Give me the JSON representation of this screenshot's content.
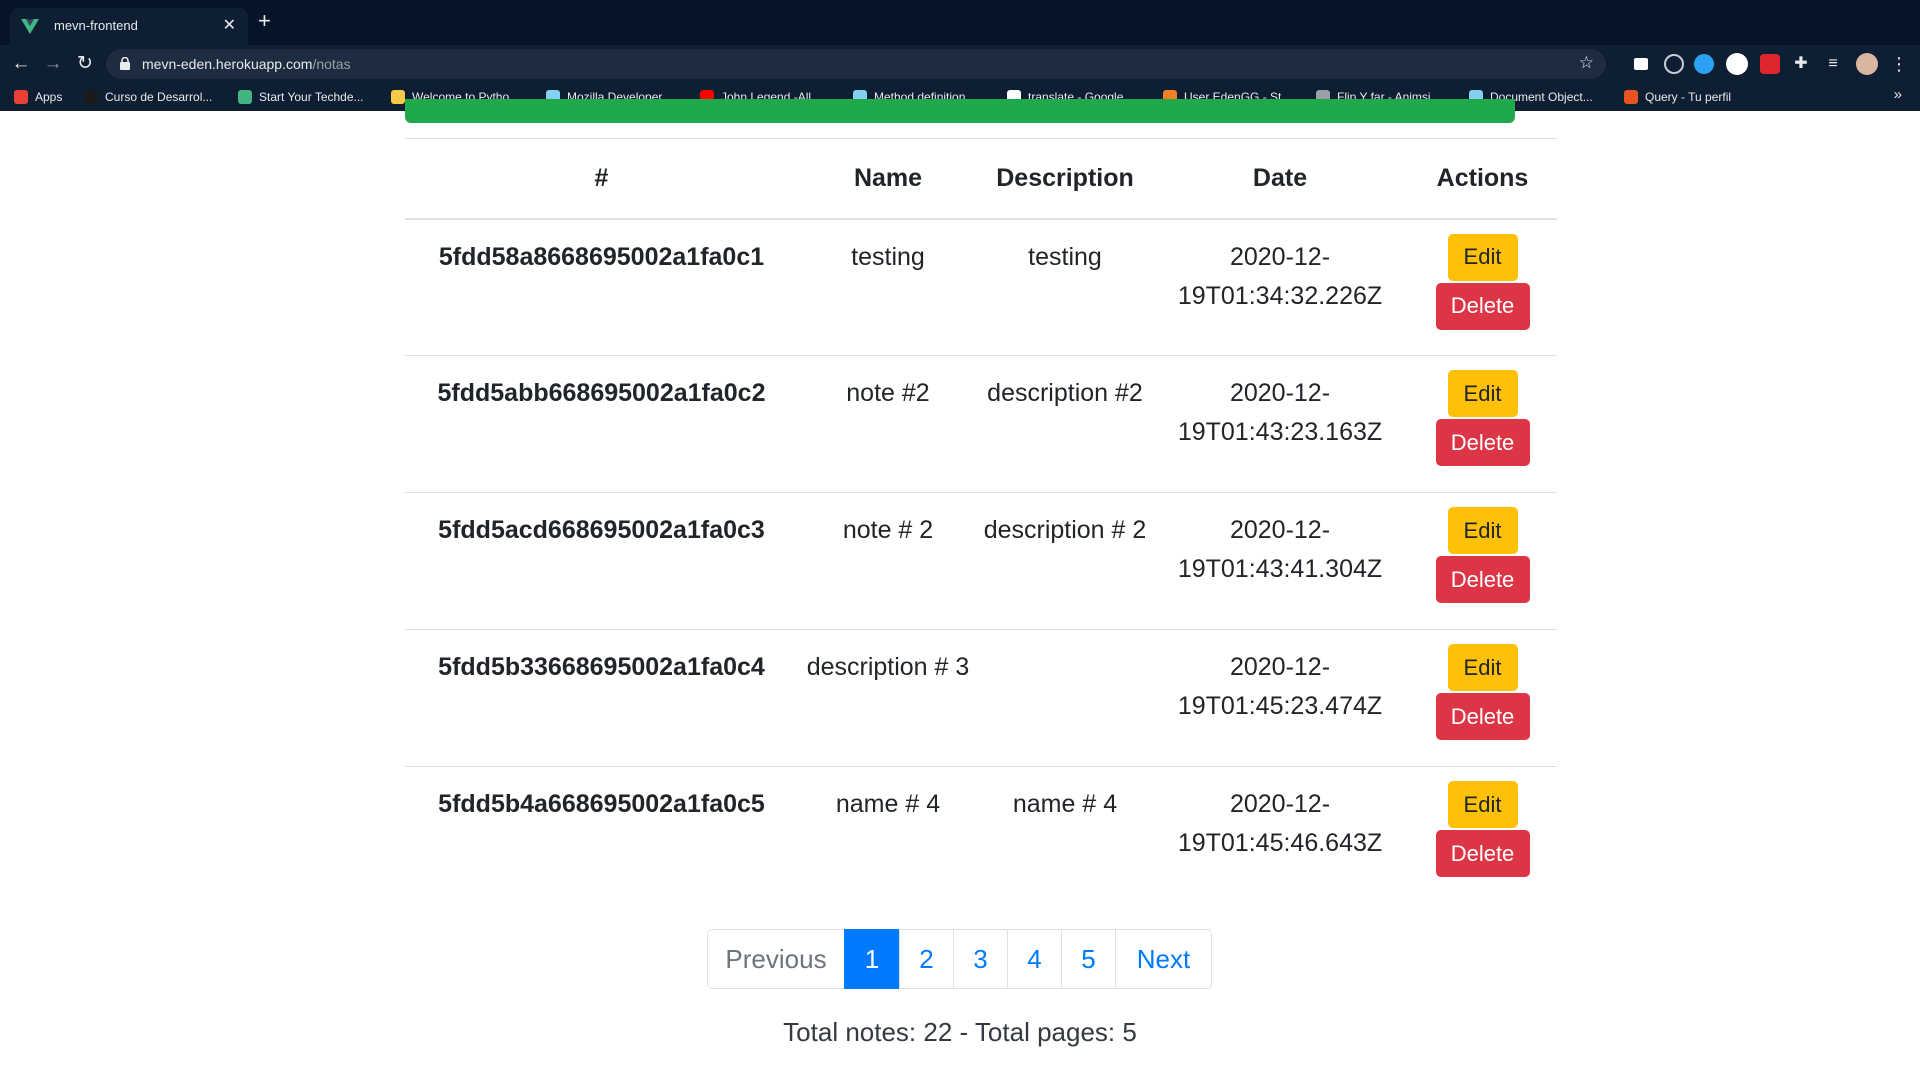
{
  "browser": {
    "tab_title": "mevn-frontend",
    "url_host": "mevn-eden.herokuapp.com",
    "url_path": "/notas",
    "bookmarks": [
      {
        "label": "Apps",
        "icon": "apps-grid-icon",
        "color": "#e94235"
      },
      {
        "label": "Curso de Desarrol...",
        "icon": "course-icon",
        "color": "#1a1a1a"
      },
      {
        "label": "Start Your Techde...",
        "icon": "gear-icon",
        "color": "#43b581"
      },
      {
        "label": "Welcome to Pytho...",
        "icon": "python-icon",
        "color": "#f7c948"
      },
      {
        "label": "Mozilla Developer...",
        "icon": "mdn-icon",
        "color": "#83d0f2"
      },
      {
        "label": "John Legend -All...",
        "icon": "youtube-icon",
        "color": "#ff0000"
      },
      {
        "label": "Method definition...",
        "icon": "mdn-icon",
        "color": "#83d0f2"
      },
      {
        "label": "translate - Google...",
        "icon": "google-icon",
        "color": "#ffffff"
      },
      {
        "label": "User EdenGG - St...",
        "icon": "stackoverflow-icon",
        "color": "#f48024"
      },
      {
        "label": "Flip Y far - Animsi...",
        "icon": "globe-icon",
        "color": "#9aa0a6"
      },
      {
        "label": "Document Object...",
        "icon": "mdn-icon",
        "color": "#83d0f2"
      },
      {
        "label": "Query - Tu perfil",
        "icon": "query-icon",
        "color": "#e8541f"
      }
    ]
  },
  "table": {
    "headers": [
      "#",
      "Name",
      "Description",
      "Date",
      "Actions"
    ],
    "rows": [
      {
        "id": "5fdd58a8668695002a1fa0c1",
        "name": "testing",
        "description": "testing",
        "date": "2020-12-19T01:34:32.226Z"
      },
      {
        "id": "5fdd5abb668695002a1fa0c2",
        "name": "note #2",
        "description": "description #2",
        "date": "2020-12-19T01:43:23.163Z"
      },
      {
        "id": "5fdd5acd668695002a1fa0c3",
        "name": "note # 2",
        "description": "description # 2",
        "date": "2020-12-19T01:43:41.304Z"
      },
      {
        "id": "5fdd5b33668695002a1fa0c4",
        "name": "description # 3",
        "description": "",
        "date": "2020-12-19T01:45:23.474Z"
      },
      {
        "id": "5fdd5b4a668695002a1fa0c5",
        "name": "name # 4",
        "description": "name # 4",
        "date": "2020-12-19T01:45:46.643Z"
      }
    ],
    "edit_label": "Edit",
    "delete_label": "Delete"
  },
  "pagination": {
    "previous_label": "Previous",
    "next_label": "Next",
    "pages": [
      "1",
      "2",
      "3",
      "4",
      "5"
    ],
    "active_page": "1"
  },
  "totals": "Total notes: 22 - Total pages: 5",
  "colors": {
    "edit": "#ffc107",
    "delete": "#dc3545",
    "primary": "#007bff",
    "alert_success": "#1fa94a"
  }
}
